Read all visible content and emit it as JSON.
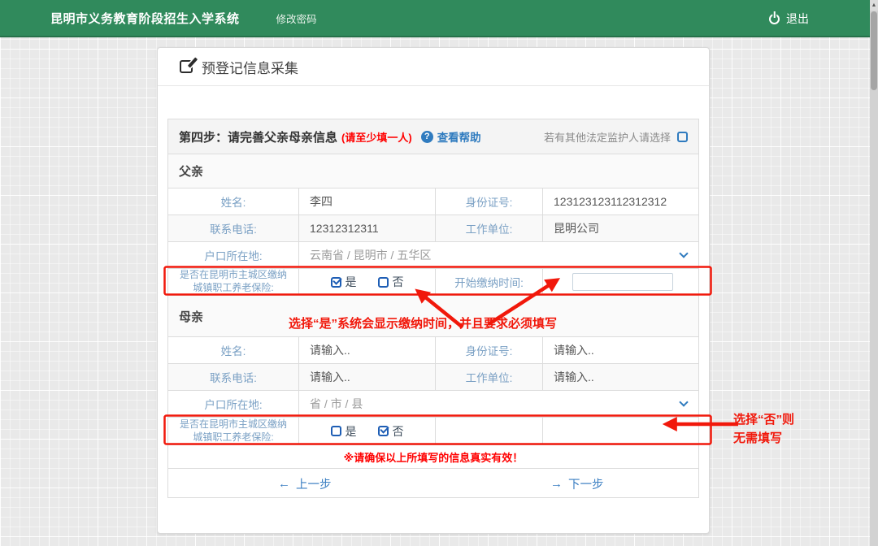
{
  "colors": {
    "navbar_green": "#308a5c",
    "accent_blue": "#2f7bbf",
    "label_blue": "#7aa0c4",
    "checkbox_blue": "#1e5eb5",
    "annotation_red": "#f1180b",
    "notice_red": "#ff0000",
    "table_border": "#dcdcdc"
  },
  "icons": {
    "scroll_up": "▲",
    "help_glyph": "?"
  },
  "navbar": {
    "brand": "昆明市义务教育阶段招生入学系统",
    "change_password": "修改密码",
    "logout": "退出"
  },
  "panel": {
    "title": "预登记信息采集"
  },
  "step": {
    "title": "第四步：请完善父亲母亲信息",
    "subtitle": "(请至少填一人)",
    "help_link": "查看帮助",
    "guardian_hint": "若有其他法定监护人请选择"
  },
  "labels": {
    "name": "姓名:",
    "id_number": "身份证号:",
    "phone": "联系电话:",
    "employer": "工作单位:",
    "residence": "户口所在地:",
    "insurance_line1": "是否在昆明市主城区缴纳",
    "insurance_line2": "城镇职工养老保险:",
    "yes": "是",
    "no": "否",
    "pay_start": "开始缴纳时间:"
  },
  "father": {
    "section": "父亲",
    "name": "李四",
    "id_number": "123123123112312312",
    "phone": "12312312311",
    "employer": "昆明公司",
    "residence": "云南省 /  昆明市 /  五华区",
    "insurance_selected": "是",
    "pay_start_value": ""
  },
  "mother": {
    "section": "母亲",
    "name_placeholder": "请输入..",
    "id_placeholder": "请输入..",
    "phone_placeholder": "请输入..",
    "employer_placeholder": "请输入..",
    "residence": "省 /  市 /  县",
    "insurance_selected": "否"
  },
  "footer": {
    "notice": "※请确保以上所填写的信息真实有效！",
    "prev_icon": "←",
    "prev": "上一步",
    "next_icon": "→",
    "next": "下一步"
  },
  "annotations": {
    "yes_note": "选择“是”系统会显示缴纳时间，并且要求必须填写",
    "no_note_line1": "选择“否”则",
    "no_note_line2": "无需填写"
  }
}
